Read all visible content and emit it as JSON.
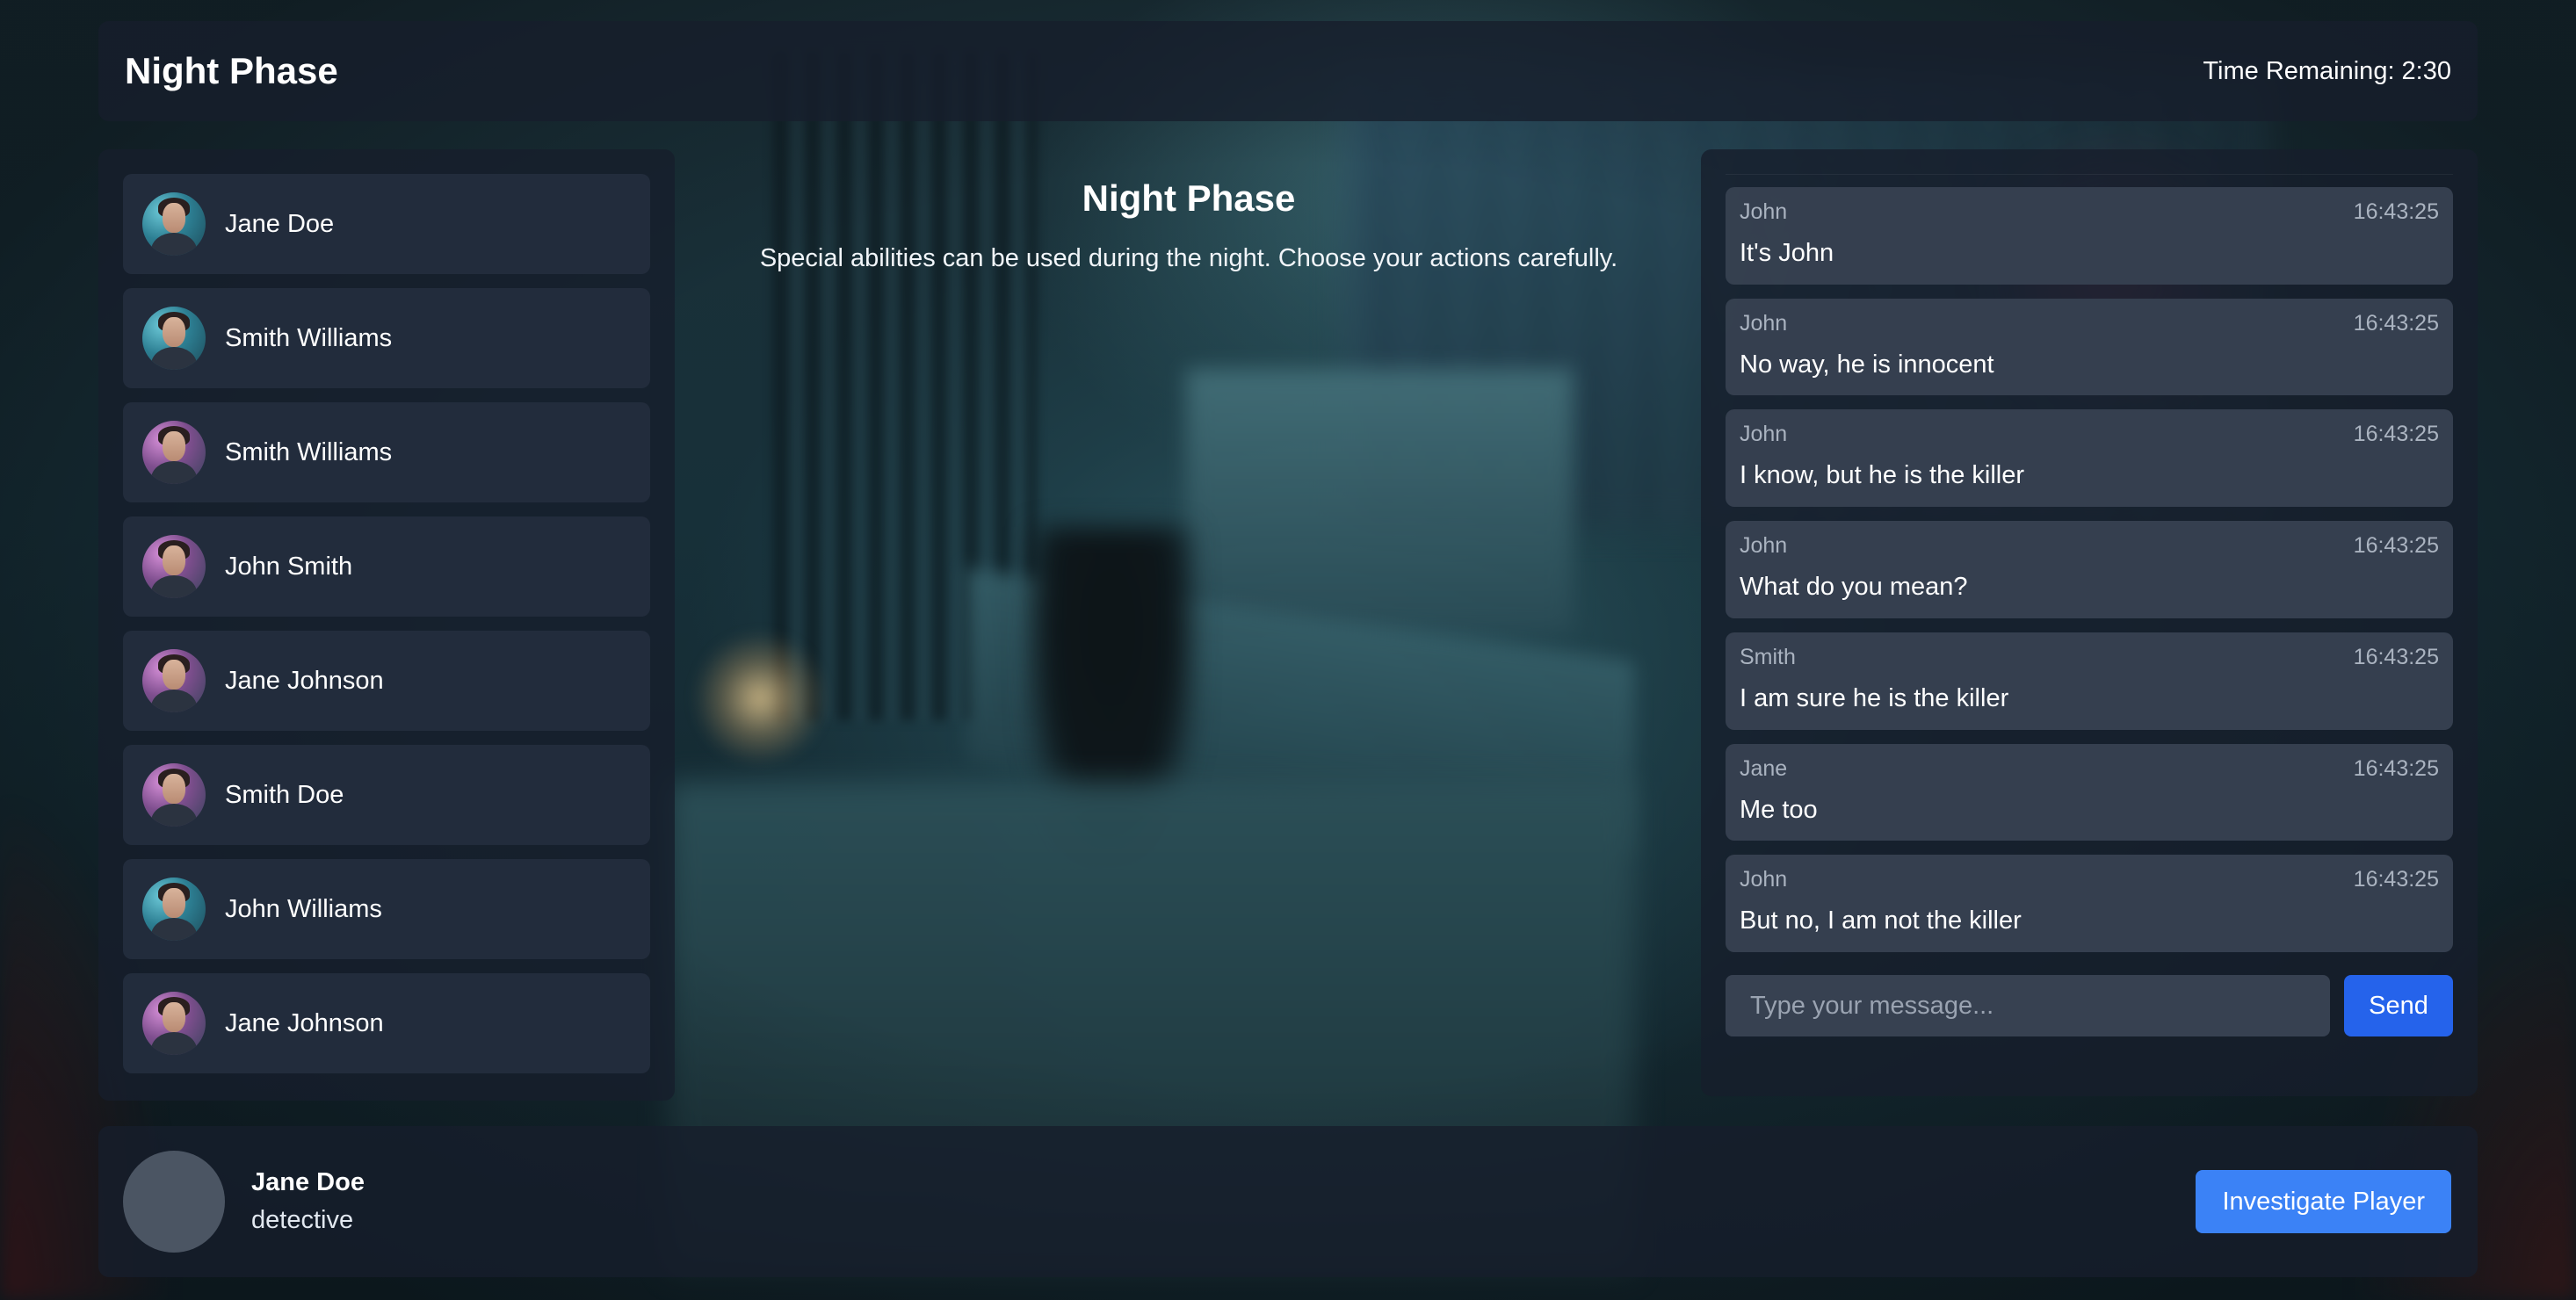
{
  "header": {
    "title": "Night Phase",
    "timer": "Time Remaining: 2:30"
  },
  "players": [
    {
      "name": "Jane Doe",
      "avatar_icon": "male-cyberpunk-portrait-icon"
    },
    {
      "name": "Smith Williams",
      "avatar_icon": "male-cyberpunk-portrait-icon"
    },
    {
      "name": "Smith Williams",
      "avatar_icon": "female-cyberpunk-portrait-icon"
    },
    {
      "name": "John Smith",
      "avatar_icon": "female-cyberpunk-portrait-icon"
    },
    {
      "name": "Jane Johnson",
      "avatar_icon": "female-cyberpunk-portrait-icon"
    },
    {
      "name": "Smith Doe",
      "avatar_icon": "female-cyberpunk-portrait-icon"
    },
    {
      "name": "John Williams",
      "avatar_icon": "male-cyberpunk-portrait-icon"
    },
    {
      "name": "Jane Johnson",
      "avatar_icon": "female-cyberpunk-portrait-icon"
    }
  ],
  "phase": {
    "title": "Night Phase",
    "description": "Special abilities can be used during the night. Choose your actions carefully."
  },
  "chat": {
    "messages": [
      {
        "sender": "John",
        "time": "16:43:25",
        "text": "It's John"
      },
      {
        "sender": "John",
        "time": "16:43:25",
        "text": "No way, he is innocent"
      },
      {
        "sender": "John",
        "time": "16:43:25",
        "text": "I know, but he is the killer"
      },
      {
        "sender": "John",
        "time": "16:43:25",
        "text": "What do you mean?"
      },
      {
        "sender": "Smith",
        "time": "16:43:25",
        "text": "I am sure he is the killer"
      },
      {
        "sender": "Jane",
        "time": "16:43:25",
        "text": "Me too"
      },
      {
        "sender": "John",
        "time": "16:43:25",
        "text": "But no, I am not the killer"
      }
    ],
    "input_placeholder": "Type your message...",
    "input_value": "",
    "send_label": "Send"
  },
  "current_player": {
    "name": "Jane Doe",
    "role": "detective"
  },
  "action": {
    "label": "Investigate Player"
  },
  "colors": {
    "send_button": "#2563eb",
    "action_button": "#3b82f6",
    "panel": "#161e2c"
  }
}
